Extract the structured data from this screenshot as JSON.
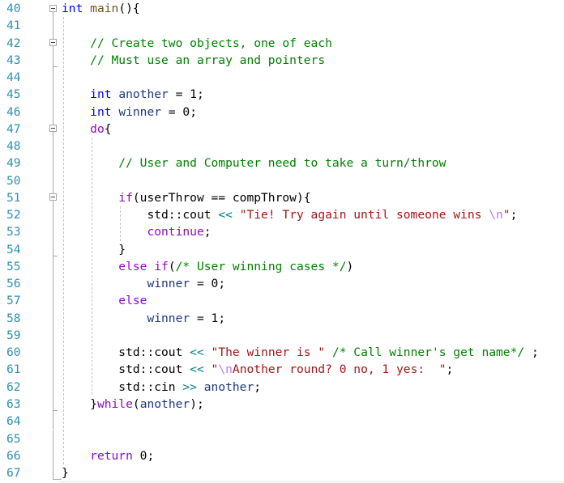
{
  "editor": {
    "theme": {
      "background": "#ffffff",
      "line_number": "#2b91af",
      "outline": "#a5a5a5",
      "indent_guide": "#c4c4c4",
      "plain": "#000000",
      "ws": "#000000",
      "keyword": "#0000ff",
      "control": "#8f08c4",
      "function": "#74531f",
      "local": "#1f377f",
      "comment": "#008000",
      "string": "#a31515",
      "escape": "#b776fb",
      "operator": "#008080",
      "number": "#000000"
    },
    "lines": [
      {
        "number": "40",
        "fold": "start",
        "tokens": [
          {
            "text": "int",
            "type": "keyword"
          },
          {
            "text": " ",
            "type": "plain"
          },
          {
            "text": "main",
            "type": "function"
          },
          {
            "text": "(){",
            "type": "plain"
          }
        ]
      },
      {
        "number": "41",
        "fold": "body",
        "tokens": []
      },
      {
        "number": "42",
        "fold": "start",
        "tokens": [
          {
            "text": "    ",
            "type": "ws"
          },
          {
            "text": "// Create two objects, one of each",
            "type": "comment"
          }
        ]
      },
      {
        "number": "43",
        "fold": "end",
        "tokens": [
          {
            "text": "    ",
            "type": "ws"
          },
          {
            "text": "// Must use an array and pointers",
            "type": "comment"
          }
        ]
      },
      {
        "number": "44",
        "fold": "body",
        "tokens": []
      },
      {
        "number": "45",
        "fold": "body",
        "tokens": [
          {
            "text": "    ",
            "type": "ws"
          },
          {
            "text": "int",
            "type": "keyword"
          },
          {
            "text": " ",
            "type": "plain"
          },
          {
            "text": "another",
            "type": "local"
          },
          {
            "text": " = ",
            "type": "plain"
          },
          {
            "text": "1",
            "type": "number"
          },
          {
            "text": ";",
            "type": "plain"
          }
        ]
      },
      {
        "number": "46",
        "fold": "body",
        "tokens": [
          {
            "text": "    ",
            "type": "ws"
          },
          {
            "text": "int",
            "type": "keyword"
          },
          {
            "text": " ",
            "type": "plain"
          },
          {
            "text": "winner",
            "type": "local"
          },
          {
            "text": " = ",
            "type": "plain"
          },
          {
            "text": "0",
            "type": "number"
          },
          {
            "text": ";",
            "type": "plain"
          }
        ]
      },
      {
        "number": "47",
        "fold": "start",
        "tokens": [
          {
            "text": "    ",
            "type": "ws"
          },
          {
            "text": "do",
            "type": "control"
          },
          {
            "text": "{",
            "type": "plain"
          }
        ]
      },
      {
        "number": "48",
        "fold": "body",
        "tokens": []
      },
      {
        "number": "49",
        "fold": "body",
        "tokens": [
          {
            "text": "        ",
            "type": "ws"
          },
          {
            "text": "// User and Computer need to take a turn/throw",
            "type": "comment"
          }
        ]
      },
      {
        "number": "50",
        "fold": "body",
        "tokens": []
      },
      {
        "number": "51",
        "fold": "start",
        "tokens": [
          {
            "text": "        ",
            "type": "ws"
          },
          {
            "text": "if",
            "type": "control"
          },
          {
            "text": "(userThrow == compThrow){",
            "type": "plain"
          }
        ]
      },
      {
        "number": "52",
        "fold": "body",
        "tokens": [
          {
            "text": "            ",
            "type": "ws"
          },
          {
            "text": "std::cout ",
            "type": "plain"
          },
          {
            "text": "<<",
            "type": "operator"
          },
          {
            "text": " ",
            "type": "plain"
          },
          {
            "text": "\"Tie! Try again until someone wins ",
            "type": "string"
          },
          {
            "text": "\\n",
            "type": "escape"
          },
          {
            "text": "\"",
            "type": "string"
          },
          {
            "text": ";",
            "type": "plain"
          }
        ]
      },
      {
        "number": "53",
        "fold": "body",
        "tokens": [
          {
            "text": "            ",
            "type": "ws"
          },
          {
            "text": "continue",
            "type": "control"
          },
          {
            "text": ";",
            "type": "plain"
          }
        ]
      },
      {
        "number": "54",
        "fold": "end",
        "tokens": [
          {
            "text": "        ",
            "type": "ws"
          },
          {
            "text": "}",
            "type": "plain"
          }
        ]
      },
      {
        "number": "55",
        "fold": "body",
        "tokens": [
          {
            "text": "        ",
            "type": "ws"
          },
          {
            "text": "else if",
            "type": "control"
          },
          {
            "text": "(",
            "type": "plain"
          },
          {
            "text": "/* User winning cases */",
            "type": "comment"
          },
          {
            "text": ")",
            "type": "plain"
          }
        ]
      },
      {
        "number": "56",
        "fold": "body",
        "tokens": [
          {
            "text": "            ",
            "type": "ws"
          },
          {
            "text": "winner",
            "type": "local"
          },
          {
            "text": " = ",
            "type": "plain"
          },
          {
            "text": "0",
            "type": "number"
          },
          {
            "text": ";",
            "type": "plain"
          }
        ]
      },
      {
        "number": "57",
        "fold": "body",
        "tokens": [
          {
            "text": "        ",
            "type": "ws"
          },
          {
            "text": "else",
            "type": "control"
          }
        ]
      },
      {
        "number": "58",
        "fold": "body",
        "tokens": [
          {
            "text": "            ",
            "type": "ws"
          },
          {
            "text": "winner",
            "type": "local"
          },
          {
            "text": " = ",
            "type": "plain"
          },
          {
            "text": "1",
            "type": "number"
          },
          {
            "text": ";",
            "type": "plain"
          }
        ]
      },
      {
        "number": "59",
        "fold": "body",
        "tokens": []
      },
      {
        "number": "60",
        "fold": "body",
        "tokens": [
          {
            "text": "        ",
            "type": "ws"
          },
          {
            "text": "std::cout ",
            "type": "plain"
          },
          {
            "text": "<<",
            "type": "operator"
          },
          {
            "text": " ",
            "type": "plain"
          },
          {
            "text": "\"The winner is \"",
            "type": "string"
          },
          {
            "text": " ",
            "type": "plain"
          },
          {
            "text": "/* Call winner's get name*/",
            "type": "comment"
          },
          {
            "text": " ;",
            "type": "plain"
          }
        ]
      },
      {
        "number": "61",
        "fold": "body",
        "tokens": [
          {
            "text": "        ",
            "type": "ws"
          },
          {
            "text": "std::cout ",
            "type": "plain"
          },
          {
            "text": "<<",
            "type": "operator"
          },
          {
            "text": " ",
            "type": "plain"
          },
          {
            "text": "\"",
            "type": "string"
          },
          {
            "text": "\\n",
            "type": "escape"
          },
          {
            "text": "Another round? 0 no, 1 yes:  \"",
            "type": "string"
          },
          {
            "text": ";",
            "type": "plain"
          }
        ]
      },
      {
        "number": "62",
        "fold": "body",
        "tokens": [
          {
            "text": "        ",
            "type": "ws"
          },
          {
            "text": "std::cin ",
            "type": "plain"
          },
          {
            "text": ">>",
            "type": "operator"
          },
          {
            "text": " ",
            "type": "plain"
          },
          {
            "text": "another",
            "type": "local"
          },
          {
            "text": ";",
            "type": "plain"
          }
        ]
      },
      {
        "number": "63",
        "fold": "end",
        "tokens": [
          {
            "text": "    ",
            "type": "ws"
          },
          {
            "text": "}",
            "type": "plain"
          },
          {
            "text": "while",
            "type": "control"
          },
          {
            "text": "(",
            "type": "plain"
          },
          {
            "text": "another",
            "type": "local"
          },
          {
            "text": ");",
            "type": "plain"
          }
        ]
      },
      {
        "number": "64",
        "fold": "body",
        "tokens": []
      },
      {
        "number": "65",
        "fold": "body",
        "tokens": []
      },
      {
        "number": "66",
        "fold": "body",
        "tokens": [
          {
            "text": "    ",
            "type": "ws"
          },
          {
            "text": "return",
            "type": "control"
          },
          {
            "text": " ",
            "type": "plain"
          },
          {
            "text": "0",
            "type": "number"
          },
          {
            "text": ";",
            "type": "plain"
          }
        ]
      },
      {
        "number": "67",
        "fold": "last",
        "tokens": [
          {
            "text": "}",
            "type": "plain"
          }
        ]
      }
    ]
  }
}
